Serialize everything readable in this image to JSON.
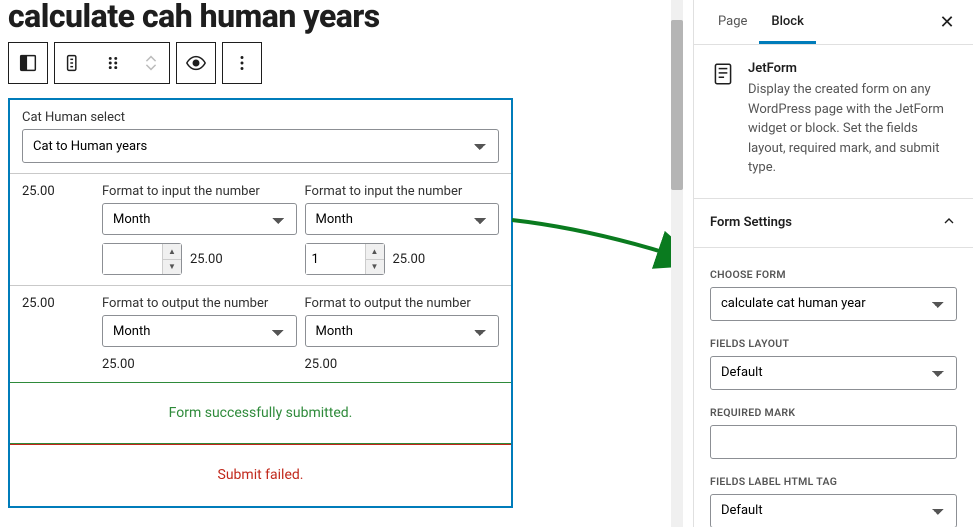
{
  "title": "calculate cah human years",
  "toolbar_icons": [
    "layout",
    "align",
    "drag",
    "move",
    "preview",
    "more"
  ],
  "block": {
    "select_label": "Cat Human select",
    "select_value": "Cat to Human years",
    "group1": {
      "left_value": "25.00",
      "left_col": {
        "label": "Format to input the number",
        "select_value": "Month",
        "number_value": "",
        "number_side": "25.00"
      },
      "right_col": {
        "label": "Format to input the number",
        "select_value": "Month",
        "number_value": "1",
        "number_side": "25.00"
      }
    },
    "group2": {
      "left_value": "25.00",
      "left_col": {
        "label": "Format to output the number",
        "select_value": "Month",
        "result": "25.00"
      },
      "right_col": {
        "label": "Format to output the number",
        "select_value": "Month",
        "result": "25.00"
      }
    },
    "success_msg": "Form successfully submitted.",
    "error_msg": "Submit failed."
  },
  "sidebar": {
    "tab_page": "Page",
    "tab_block": "Block",
    "block_title": "JetForm",
    "block_desc": "Display the created form on any WordPress page with the JetForm widget or block. Set the fields layout, required mark, and submit type.",
    "panel_title": "Form Settings",
    "choose_form_label": "CHOOSE FORM",
    "choose_form_value": "calculate cat human year",
    "fields_layout_label": "FIELDS LAYOUT",
    "fields_layout_value": "Default",
    "required_mark_label": "REQUIRED MARK",
    "required_mark_value": "",
    "fields_label_tag_label": "FIELDS LABEL HTML TAG",
    "fields_label_tag_value": "Default"
  },
  "colors": {
    "accent": "#007cba",
    "success": "#2e8a3a",
    "error": "#c1281b"
  }
}
